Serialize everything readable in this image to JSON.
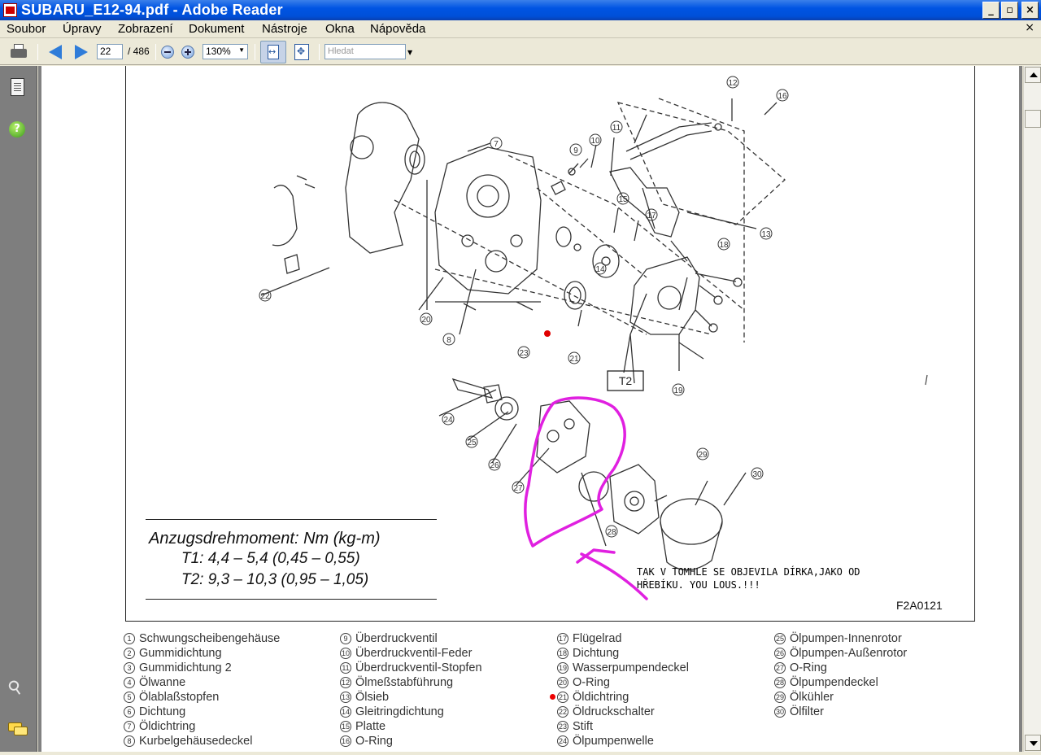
{
  "window": {
    "title": "SUBARU_E12-94.pdf - Adobe Reader",
    "btn_min": "_",
    "btn_max": "▫",
    "btn_close": "×"
  },
  "menu": {
    "items": [
      "Soubor",
      "Úpravy",
      "Zobrazení",
      "Dokument",
      "Nástroje",
      "Okna",
      "Nápověda"
    ],
    "doc_close": "×"
  },
  "toolbar": {
    "page_current": "22",
    "page_total": "/ 486",
    "zoom": "130%",
    "search_placeholder": "Hledat"
  },
  "document": {
    "torque_title": "Anzugsdrehmoment: Nm (kg-m)",
    "torque_t1": "T1:  4,4 – 5,4 (0,45 – 0,55)",
    "torque_t2": "T2:  9,3 – 10,3 (0,95 – 1,05)",
    "figure_code": "F2A0121",
    "box_label": "T2",
    "annotation_line1": "TAK V TOMHLE SE OBJEVILA DÍRKA,JAKO OD",
    "annotation_line2": "HŘEBÍKU. YOU LOUS.!!!",
    "legend_col1": [
      {
        "n": "1",
        "label": "Schwungscheibengehäuse"
      },
      {
        "n": "2",
        "label": "Gummidichtung"
      },
      {
        "n": "3",
        "label": "Gummidichtung 2"
      },
      {
        "n": "4",
        "label": "Ölwanne"
      },
      {
        "n": "5",
        "label": "Ölablaßstopfen"
      },
      {
        "n": "6",
        "label": "Dichtung"
      },
      {
        "n": "7",
        "label": "Öldichtring"
      },
      {
        "n": "8",
        "label": "Kurbelgehäusedeckel"
      }
    ],
    "legend_col2": [
      {
        "n": "9",
        "label": "Überdruckventil"
      },
      {
        "n": "10",
        "label": "Überdruckventil-Feder"
      },
      {
        "n": "11",
        "label": "Überdruckventil-Stopfen"
      },
      {
        "n": "12",
        "label": "Ölmeßstabführung"
      },
      {
        "n": "13",
        "label": "Ölsieb"
      },
      {
        "n": "14",
        "label": "Gleitringdichtung"
      },
      {
        "n": "15",
        "label": "Platte"
      },
      {
        "n": "16",
        "label": "O-Ring"
      }
    ],
    "legend_col3": [
      {
        "n": "17",
        "label": "Flügelrad"
      },
      {
        "n": "18",
        "label": "Dichtung"
      },
      {
        "n": "19",
        "label": "Wasserpumpendeckel"
      },
      {
        "n": "20",
        "label": "O-Ring"
      },
      {
        "n": "21",
        "label": "Öldichtring"
      },
      {
        "n": "22",
        "label": "Öldruckschalter"
      },
      {
        "n": "23",
        "label": "Stift"
      },
      {
        "n": "24",
        "label": "Ölpumpenwelle"
      }
    ],
    "legend_col4": [
      {
        "n": "25",
        "label": "Ölpumpen-Innenrotor"
      },
      {
        "n": "26",
        "label": "Ölpumpen-Außenrotor"
      },
      {
        "n": "27",
        "label": "O-Ring"
      },
      {
        "n": "28",
        "label": "Ölpumpendeckel"
      },
      {
        "n": "29",
        "label": "Ölkühler"
      },
      {
        "n": "30",
        "label": "Ölfilter"
      }
    ],
    "callouts": [
      "12",
      "16",
      "7",
      "9",
      "10",
      "11",
      "15",
      "17",
      "13",
      "18",
      "22",
      "20",
      "8",
      "14",
      "21",
      "19",
      "23",
      "24",
      "25",
      "26",
      "27",
      "28",
      "29",
      "30"
    ]
  },
  "colors": {
    "markup_magenta": "#e020e0",
    "marker_red": "#e00000",
    "titlebar_blue": "#0054e3"
  },
  "icons": {
    "print": "printer-icon",
    "prev": "arrow-left-icon",
    "next": "arrow-right-icon",
    "zoom_out": "zoom-out-icon",
    "zoom_in": "zoom-in-icon",
    "fit_width": "fit-width-icon",
    "fit_page": "fit-page-icon",
    "pages": "pages-panel-icon",
    "help": "help-icon",
    "attach": "paperclip-icon",
    "comments": "comments-icon"
  }
}
